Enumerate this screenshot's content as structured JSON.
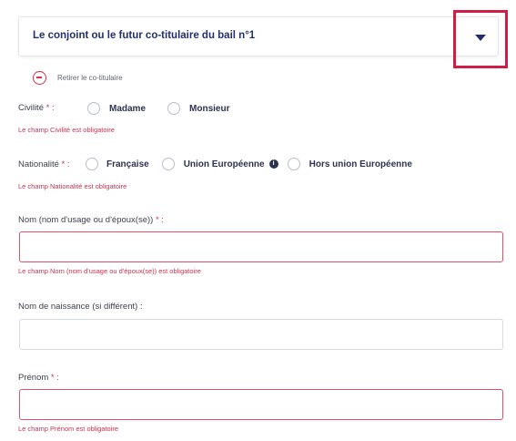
{
  "section": {
    "title": "Le conjoint ou le futur co-titulaire du bail n°1",
    "remove_label": "Retirer le co-titulaire"
  },
  "civilite": {
    "label": "Civilité",
    "required_mark": " * :",
    "options": [
      "Madame",
      "Monsieur"
    ],
    "error": "Le champ Civilité est obligatoire"
  },
  "nationalite": {
    "label": "Nationalité",
    "required_mark": " * :",
    "options": [
      "Française",
      "Union Européenne",
      "Hors union Européenne"
    ],
    "info_glyph": "i",
    "error": "Le champ Nationalité est obligatoire"
  },
  "nom": {
    "label": "Nom (nom d'usage ou d'époux(se))",
    "required_mark": " * :",
    "value": "",
    "error": "Le champ Nom (nom d'usage ou d'époux(se)) est obligatoire"
  },
  "nom_naissance": {
    "label": "Nom de naissance (si différent) :",
    "value": ""
  },
  "prenom": {
    "label": "Prénom",
    "required_mark": " * :",
    "value": "",
    "error": "Le champ Prénom est obligatoire"
  },
  "colors": {
    "accent": "#23306b",
    "error": "#d32f4d",
    "highlight_box": "#cf1f45"
  }
}
